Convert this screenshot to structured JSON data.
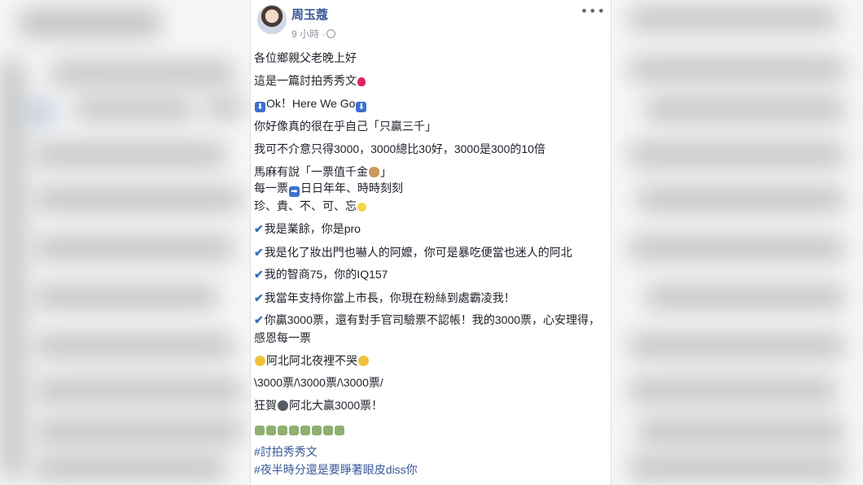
{
  "post": {
    "author": "周玉蔻",
    "time": "9 小時 ·",
    "more": "•••",
    "lines": {
      "l1": "各位鄉親父老晚上好",
      "l2": "這是一篇討拍秀秀文",
      "l3": "Ok！Here We Go",
      "l4": "你好像真的很在乎自己「只贏三千」",
      "l5": "我可不介意只得3000，3000總比30好，3000是300的10倍",
      "l6a": "馬麻有說「一票值千金",
      "l6b": "」",
      "l7a": "每一票",
      "l7b": "日日年年、時時刻刻",
      "l8": "珍、貴、不、可、忘",
      "l9": "我是業餘，你是pro",
      "l10": "我是化了妝出門也嚇人的阿嬤，你可是暴吃便當也迷人的阿北",
      "l11": "我的智商75，你的IQ157",
      "l12": "我當年支持你當上市長，你現在粉絲到處霸凌我！",
      "l13": "你贏3000票，還有對手官司驗票不認帳！我的3000票，心安理得，感恩每一票",
      "l14": "阿北阿北夜裡不哭",
      "l15": "\\3000票/\\3000票/\\3000票/",
      "l16a": "狂賀",
      "l16b": "阿北大贏3000票！"
    },
    "hashtags": [
      "#討拍秀秀文",
      "#夜半時分還是要睜著眼皮diss你"
    ]
  },
  "icons": {
    "check": "✔",
    "down_arrow": "⬇",
    "right_arrow": "➡"
  },
  "colors": {
    "link": "#385898",
    "meta": "#90949c",
    "check": "#3b6fb6"
  }
}
